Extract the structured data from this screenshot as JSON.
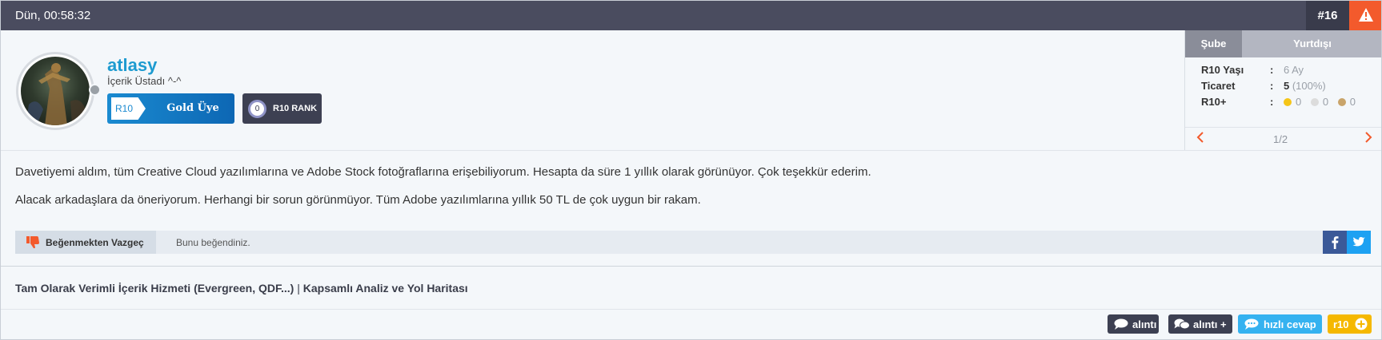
{
  "header": {
    "date": "Dün, 00:58:32",
    "post_number": "#16",
    "report_icon": "warning-icon"
  },
  "user": {
    "username": "atlasy",
    "title": "İçerik Üstadı ^-^",
    "status": "offline",
    "badges": {
      "gold_prefix": "R10",
      "gold_label": "Gold Üye",
      "rank_value": "0",
      "rank_label": "R10 RANK"
    }
  },
  "info_panel": {
    "tabs": [
      "Şube",
      "Yurtdışı"
    ],
    "active_tab": "Şube",
    "rows": [
      {
        "key": "R10 Yaşı",
        "sep": ":",
        "value": "6 Ay"
      },
      {
        "key": "Ticaret",
        "sep": ":",
        "value_bold": "5",
        "value_rest": " (100%)"
      },
      {
        "key": "R10+",
        "sep": ":",
        "counts": [
          "0",
          "0",
          "0"
        ]
      }
    ],
    "pager": "1/2"
  },
  "content": {
    "paragraphs": [
      "Davetiyemi aldım, tüm Creative Cloud yazılımlarına ve Adobe Stock fotoğraflarına erişebiliyorum. Hesapta da süre 1 yıllık olarak görünüyor. Çok teşekkür ederim.",
      "Alacak arkadaşlara da öneriyorum. Herhangi bir sorun görünmüyor. Tüm Adobe yazılımlarına yıllık 50 TL de çok uygun bir rakam."
    ]
  },
  "like_bar": {
    "unlike_label": "Beğenmekten Vazgeç",
    "liked_text": "Bunu beğendiniz."
  },
  "signature": {
    "part1": "Tam Olarak Verimli İçerik Hizmeti (Evergreen, QDF...)",
    "separator": " | ",
    "part2": "Kapsamlı Analiz ve Yol Haritası"
  },
  "footer": {
    "quote_label": "alıntı",
    "quote_plus_label": "alıntı +",
    "quick_reply_label": "hızlı cevap",
    "r10_label": "r10"
  },
  "colors": {
    "header_bg": "#4a4c5f",
    "accent_blue": "#1e9bd0",
    "report_orange": "#f35a2c",
    "quick_reply_blue": "#35b2f0",
    "r10_yellow": "#f5b800",
    "dot_gold": "#f5c518",
    "dot_silver": "#dcdcdc",
    "dot_bronze": "#c9a46a"
  }
}
